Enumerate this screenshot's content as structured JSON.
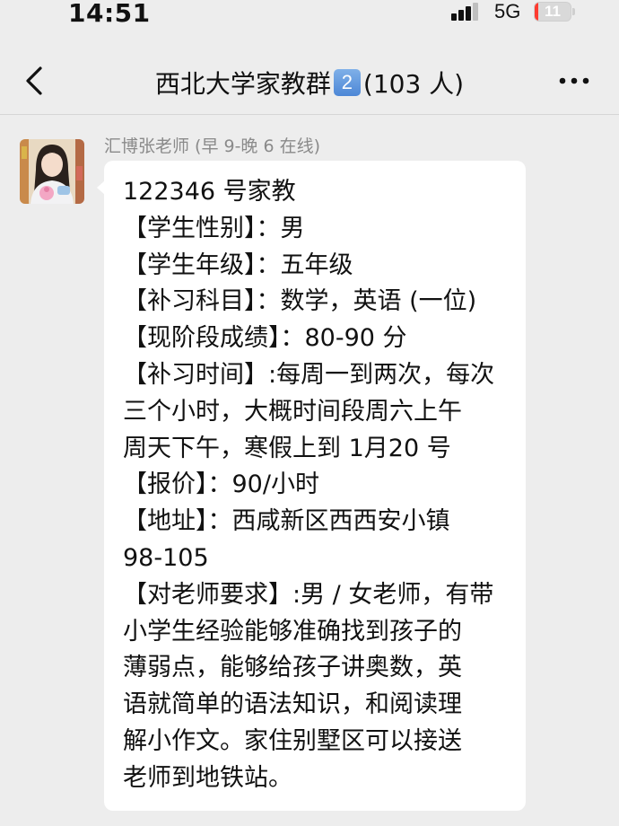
{
  "status_bar": {
    "time": "14:51",
    "network": "5G",
    "battery": "11",
    "battery_fraction": 0.11
  },
  "header": {
    "title": "西北大学家教群",
    "badge": "2",
    "member_count": "(103 人)",
    "back_icon": "chevron-left-icon",
    "more_icon": "ellipsis-icon"
  },
  "message": {
    "sender": "汇博张老师 (早 9-晚 6 在线)",
    "avatar_icon": "user-avatar",
    "lines": [
      "122346 号家教",
      "【学生性别】：男",
      "【学生年级】：五年级",
      "【补习科目】：数学，英语 (一位)",
      "【现阶段成绩】：80-90 分",
      "【补习时间】:每周一到两次，每次",
      "三个小时，大概时间段周六上午",
      "周天下午，寒假上到 1月20 号",
      "【报价】：90/小时",
      "【地址】：西咸新区西西安小镇",
      "98-105",
      "【对老师要求】:男 / 女老师，有带",
      "小学生经验能够准确找到孩子的",
      "薄弱点，能够给孩子讲奥数，英",
      "语就简单的语法知识，和阅读理",
      "解小作文。家住别墅区可以接送",
      "老师到地铁站。"
    ]
  },
  "colors": {
    "background": "#ededed",
    "bubble": "#ffffff",
    "sender_name": "#8a8a8a",
    "badge": "#4d87d6",
    "battery_low": "#ff3b30"
  }
}
